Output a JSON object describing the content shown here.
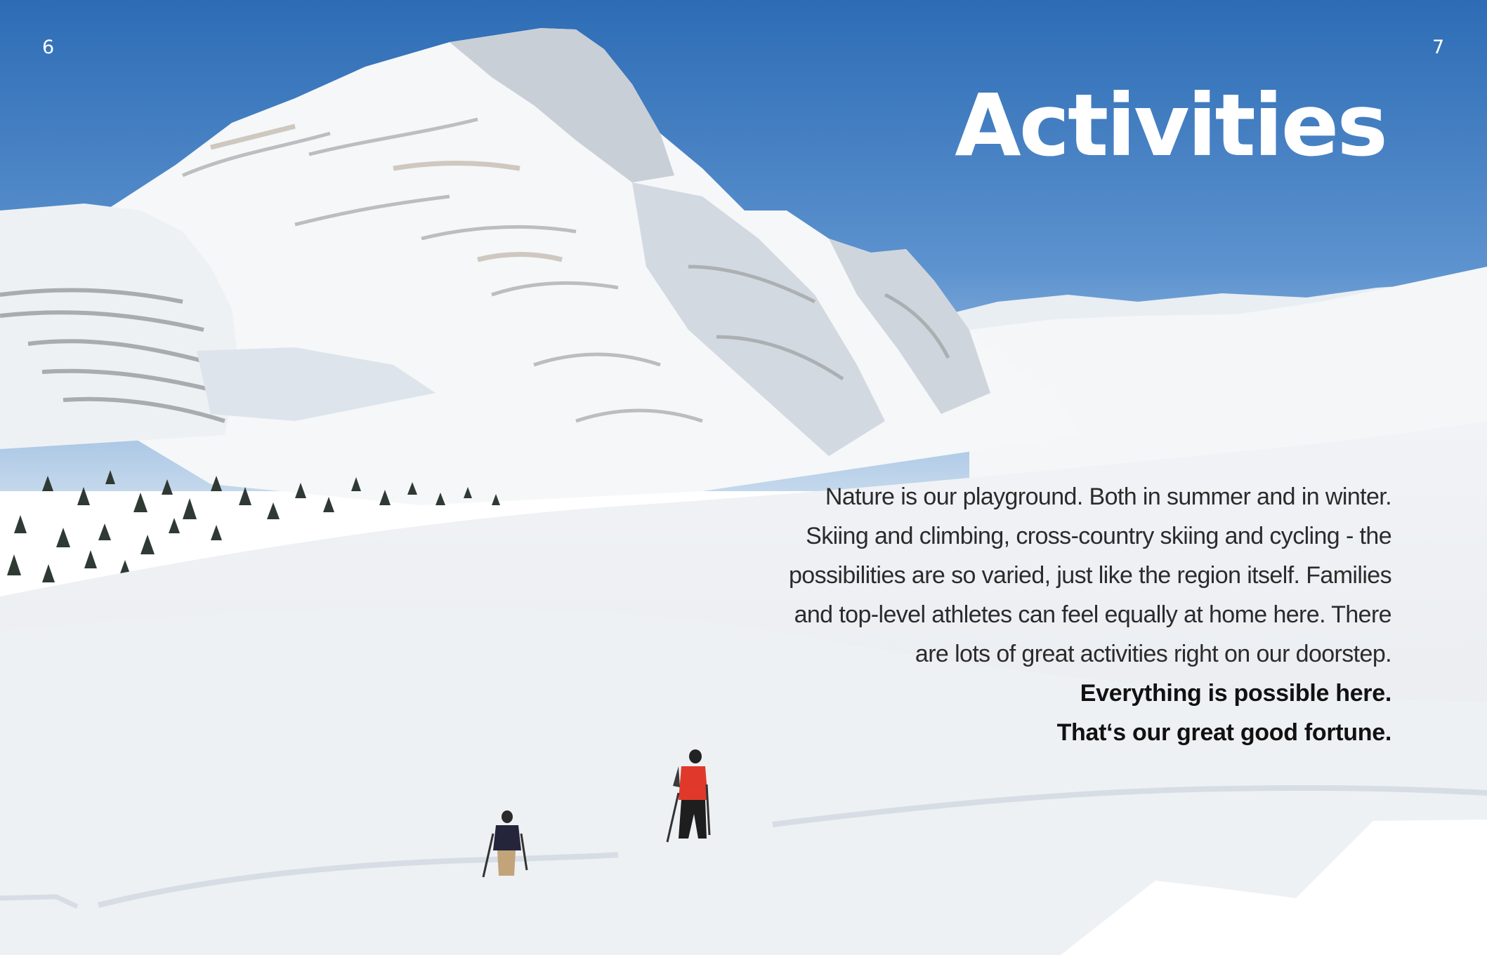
{
  "page_numbers": {
    "left": "6",
    "right": "7"
  },
  "title": "Activities",
  "body": {
    "intro": "Nature is our playground. Both in summer and in winter. Skiing and climbing, cross-country skiing and cycling - the possibilities are so varied, just like the region itself. Families and top-level athletes can feel equally at home here. There are lots of great activities right on our doorstep.",
    "highlight_line_1": "Everything is possible here.",
    "highlight_line_2": "That‘s our great good fortune."
  },
  "colors": {
    "sky_top": "#2f6fb7",
    "sky_bottom": "#bcd3ea",
    "snow": "#f3f5f7",
    "title": "#ffffff",
    "jacket_red": "#e0392b"
  }
}
